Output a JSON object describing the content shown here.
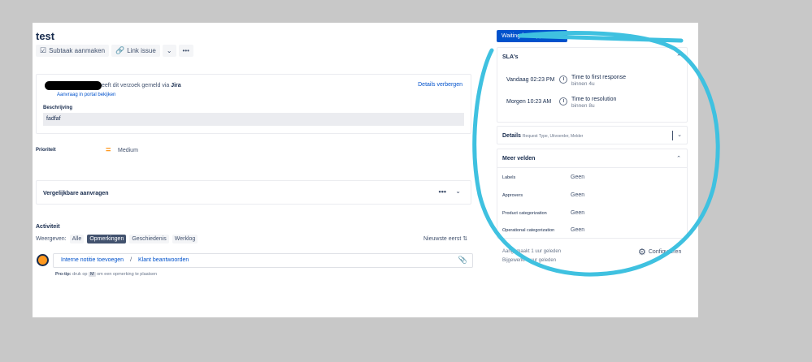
{
  "issue": {
    "title": "test",
    "toolbar": {
      "subtask_label": "Subtaak aanmaken",
      "link_label": "Link issue",
      "chevron": "⌄",
      "more": "•••"
    }
  },
  "reporter": {
    "text_tail": "eeft dit verzoek gemeld via",
    "source": "Jira",
    "portal_link": "Aanvraag in portal bekijken",
    "hide_details": "Details verbergen"
  },
  "description": {
    "label": "Beschrijving",
    "value": "fadfaf"
  },
  "priority": {
    "label": "Prioriteit",
    "icon": "=",
    "value": "Medium"
  },
  "similar": {
    "label": "Vergelijkbare aanvragen",
    "more": "•••",
    "chevron": "⌄"
  },
  "activity": {
    "title": "Activiteit",
    "show_label": "Weergeven:",
    "filters": [
      "Alle",
      "Opmerkingen",
      "Geschiedenis",
      "Werklog"
    ],
    "sort_label": "Nieuwste eerst ⇅",
    "internal_note": "Interne notitie toevoegen",
    "separator": "/",
    "reply": "Klant beantwoorden",
    "protip_label": "Pro-tip:",
    "protip_pre": "druk op",
    "protip_key": "M",
    "protip_post": "om een opmerking te plaatsen"
  },
  "sidebar": {
    "status": "Waiting for support",
    "status_chevron": "⌄",
    "sla": {
      "title": "SLA's",
      "rows": [
        {
          "when": "Vandaag 02:23 PM",
          "name": "Time to first response",
          "target": "binnen 4u"
        },
        {
          "when": "Morgen 10:23 AM",
          "name": "Time to resolution",
          "target": "binnen 8u"
        }
      ]
    },
    "details": {
      "title": "Details",
      "subtitle": "Request Type, Uitvoerder, Melder"
    },
    "more_fields": {
      "title": "Meer velden",
      "fields": [
        {
          "label": "Labels",
          "value": "Geen"
        },
        {
          "label": "Approvers",
          "value": "Geen"
        },
        {
          "label": "Product categorization",
          "value": "Geen"
        },
        {
          "label": "Operational categorization",
          "value": "Geen"
        }
      ]
    },
    "created": "Aangemaakt 1 uur geleden",
    "updated": "Bijgewerkt 1 uur geleden",
    "configure": "Configureren"
  },
  "colors": {
    "primary": "#0052cc",
    "highlight_circle": "#3fc1e0",
    "priority_medium": "#ff991f"
  }
}
